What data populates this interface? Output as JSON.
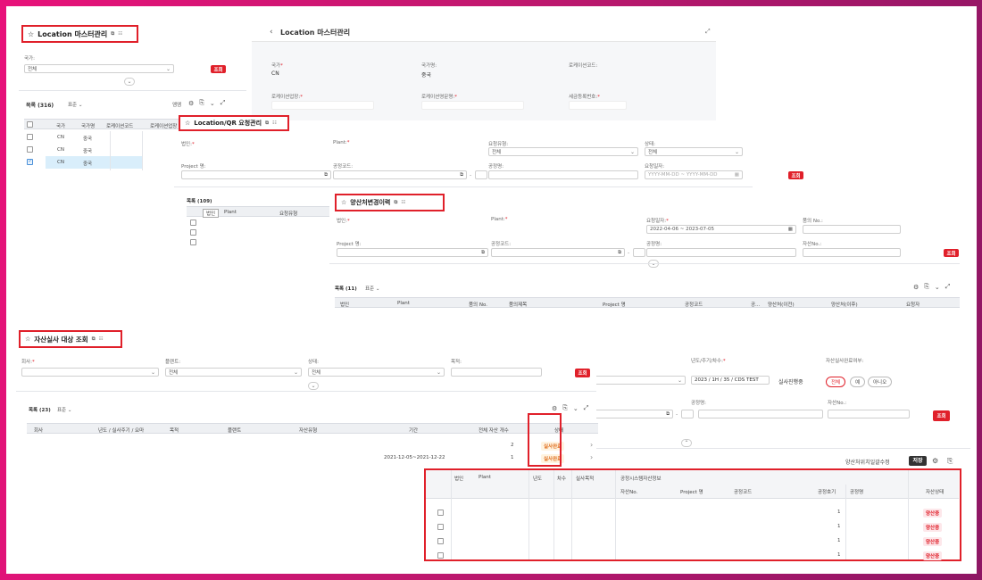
{
  "loc_master": {
    "title": "Location 마스터관리",
    "country_label": "국가:",
    "country_value": "전체",
    "search_btn": "조회",
    "list_title": "목록 (316)",
    "view_label": "표준",
    "save_label": "엠엠",
    "columns": [
      "국가",
      "국가명",
      "로케이션코드",
      "로케이션업장"
    ],
    "rows": [
      {
        "country": "CN",
        "name": "중국"
      },
      {
        "country": "CN",
        "name": "중국"
      },
      {
        "country": "CN",
        "name": "중국"
      }
    ]
  },
  "loc_detail": {
    "title": "Location 마스터관리",
    "fields": [
      {
        "label": "국가",
        "value": "CN"
      },
      {
        "label": "국가명",
        "value": "중국"
      },
      {
        "label": "로케이션코드",
        "value": ""
      },
      {
        "label": "로케이션업장",
        "value": ""
      },
      {
        "label": "로케이션영문명",
        "value": ""
      },
      {
        "label": "세금등록번호",
        "value": ""
      }
    ]
  },
  "qr_mgmt": {
    "title": "Location/QR 요청관리",
    "fields": [
      "법인",
      "Plant",
      "요청유형",
      "상태",
      "Project 명",
      "공정코드",
      "공정명",
      "요청일자"
    ],
    "type_value": "전체",
    "status_value": "전체",
    "date_placeholder": "YYYY-MM-DD ~ YYYY-MM-DD",
    "search_btn": "조회",
    "list_title": "목록 (109)",
    "columns": [
      "법인",
      "Plant",
      "요청유형"
    ]
  },
  "site_history": {
    "title": "양산처변경이력",
    "fields": [
      "법인",
      "Plant",
      "요청일자",
      "품의 No.",
      "Project 명",
      "공정코드",
      "공정명",
      "자산No."
    ],
    "date_value": "2022-04-06 ~ 2023-07-05",
    "search_btn": "조회",
    "list_title": "목록 (11)",
    "view_label": "표준",
    "columns": [
      "법인",
      "Plant",
      "품의 No.",
      "품의제목",
      "Project 명",
      "공정코드",
      "공...",
      "양산처(이전)",
      "양산처(이후)",
      "요청자"
    ]
  },
  "audit": {
    "title": "자산실사 대상 조회",
    "fields": [
      "회사",
      "플랜트",
      "상태",
      "목적"
    ],
    "plant_value": "전체",
    "status_value": "전체",
    "search_btn": "조회",
    "list_title": "목록 (23)",
    "view_label": "표준",
    "columns": [
      "회사",
      "년도 / 실사주기 / 요마",
      "목적",
      "플랜트",
      "자산유형",
      "기간",
      "전체 자산 개수",
      "상태"
    ],
    "rows": [
      {
        "period": "",
        "count": "2",
        "status": "실사완료"
      },
      {
        "period": "2021-12-05~2021-12-22",
        "count": "1",
        "status": "실사완료"
      }
    ]
  },
  "audit_detail": {
    "year_label": "년도/주기/차수:",
    "year_value": "2023 / 1H / 35 / CDS TEST",
    "progress_label": "실사진행중",
    "done_label": "자산실사완료여부:",
    "pills": [
      "전체",
      "예",
      "아니오"
    ],
    "process_label": "공정명:",
    "asset_label": "자산No.:",
    "search_btn": "조회",
    "edit_label": "양산처위치일괄수정",
    "save_btn": "저장",
    "group_header": "공정시스템자산정보",
    "columns": [
      "법인",
      "Plant",
      "년도",
      "차수",
      "실사목적",
      "자산No.",
      "Project 명",
      "공정코드",
      "공정호기",
      "공정명",
      "자산상태"
    ],
    "rows": [
      {
        "unit": "1",
        "status": "양산중"
      },
      {
        "unit": "1",
        "status": "양산중"
      },
      {
        "unit": "1",
        "status": "양산중"
      },
      {
        "unit": "1",
        "status": "양산중"
      }
    ]
  }
}
